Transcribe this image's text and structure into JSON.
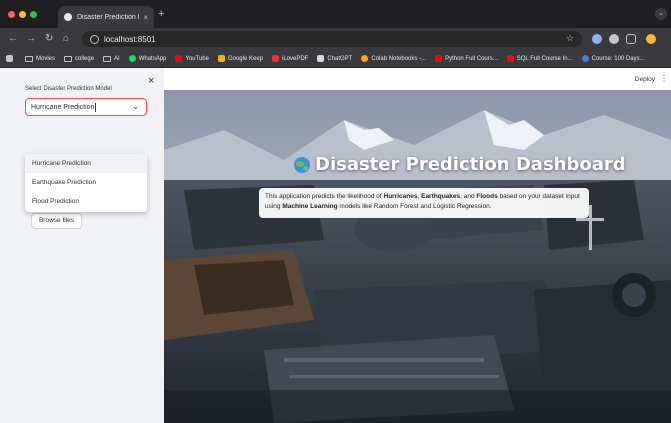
{
  "browser": {
    "tab_title": "Disaster Prediction Dashboar",
    "tab_close": "×",
    "new_tab": "+",
    "url": "localhost:8501",
    "bookmarks": [
      {
        "label": "Movies",
        "icon": "folder-icon"
      },
      {
        "label": "college",
        "icon": "folder-icon"
      },
      {
        "label": "AI",
        "icon": "folder-icon"
      },
      {
        "label": "WhatsApp",
        "icon": "whatsapp-icon",
        "color": "#25d366"
      },
      {
        "label": "YouTube",
        "icon": "youtube-icon",
        "color": "#ff0000"
      },
      {
        "label": "Google Keep",
        "icon": "keep-icon",
        "color": "#f7b500"
      },
      {
        "label": "iLovePDF",
        "icon": "ilovepdf-icon",
        "color": "#e5322d"
      },
      {
        "label": "ChatGPT",
        "icon": "chatgpt-icon",
        "color": "#d9d9d9"
      },
      {
        "label": "Colab Notebooks -...",
        "icon": "colab-icon",
        "color": "#f9ab00"
      },
      {
        "label": "Python Full Cours...",
        "icon": "youtube-icon",
        "color": "#ff0000"
      },
      {
        "label": "SQL Full Course In...",
        "icon": "youtube-icon",
        "color": "#ff0000"
      },
      {
        "label": "Course: 100 Days...",
        "icon": "course-icon",
        "color": "#4a7bd8"
      }
    ]
  },
  "sidebar": {
    "close_icon": "×",
    "select_label": "Select Disaster Prediction Model",
    "select_value": "Hurricane Prediction",
    "select_chevron": "⌄",
    "options": [
      "Hurricane Prediction",
      "Earthquake Prediction",
      "Flood Prediction"
    ],
    "browse_label": "Browse files"
  },
  "header": {
    "deploy_label": "Deploy",
    "menu_icon": "⋮"
  },
  "main": {
    "title": "Disaster Prediction Dashboard",
    "desc_1": "This application predicts the likelihood of ",
    "desc_hurricanes": "Hurricanes",
    "desc_2": ", ",
    "desc_earthquakes": "Earthquakes",
    "desc_3": ", and ",
    "desc_floods": "Floods",
    "desc_4": " based on your dataset input using ",
    "desc_ml": "Machine Learning",
    "desc_5": " models like Random Forest and Logistic Regression."
  },
  "colors": {
    "accent": "#ff4b4b",
    "sidebar_bg": "#f0f2f6",
    "text": "#31333f"
  }
}
